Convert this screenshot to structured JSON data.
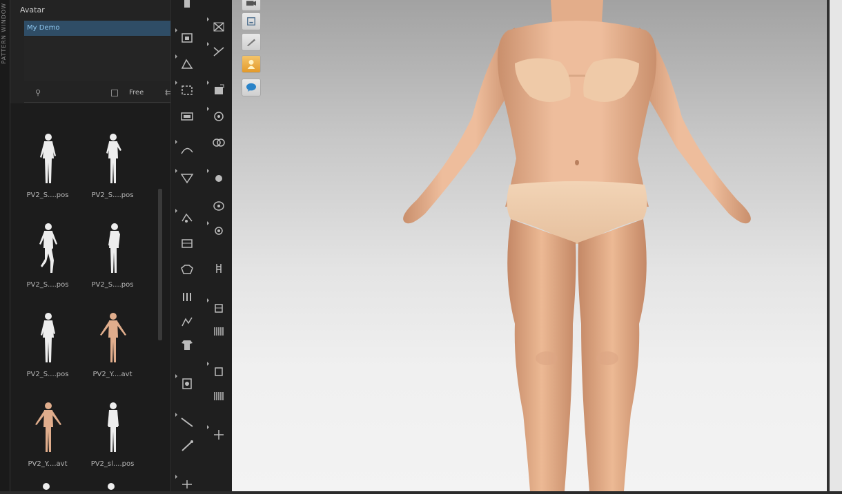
{
  "left_strip": {
    "text": "PATTERN WINDOW"
  },
  "avatar_panel": {
    "title": "Avatar",
    "selected_item": "My Demo"
  },
  "library": {
    "search_placeholder": "",
    "search_icon": "search-icon",
    "free_label": "Free",
    "filter_icon": "filter-icon",
    "items": [
      {
        "label": "PV2_S....pos",
        "figure": "white"
      },
      {
        "label": "PV2_S....pos",
        "figure": "white"
      },
      {
        "label": "PV2_S....pos",
        "figure": "white"
      },
      {
        "label": "PV2_S....pos",
        "figure": "white"
      },
      {
        "label": "PV2_S....pos",
        "figure": "white"
      },
      {
        "label": "PV2_Y....avt",
        "figure": "skin"
      },
      {
        "label": "PV2_Y....avt",
        "figure": "skin"
      },
      {
        "label": "PV2_sl....pos",
        "figure": "white"
      }
    ]
  },
  "viewport_toolbar": {
    "buttons": [
      "camera-icon",
      "front-view-icon",
      "pencil-icon",
      "avatar-icon",
      "speech-icon"
    ]
  },
  "colors": {
    "panel_bg": "#232323",
    "selection_bg": "#2f4d66",
    "skin": "#e8b896",
    "viewport_top": "#a2a2a2",
    "viewport_bottom": "#f3f3f3"
  }
}
